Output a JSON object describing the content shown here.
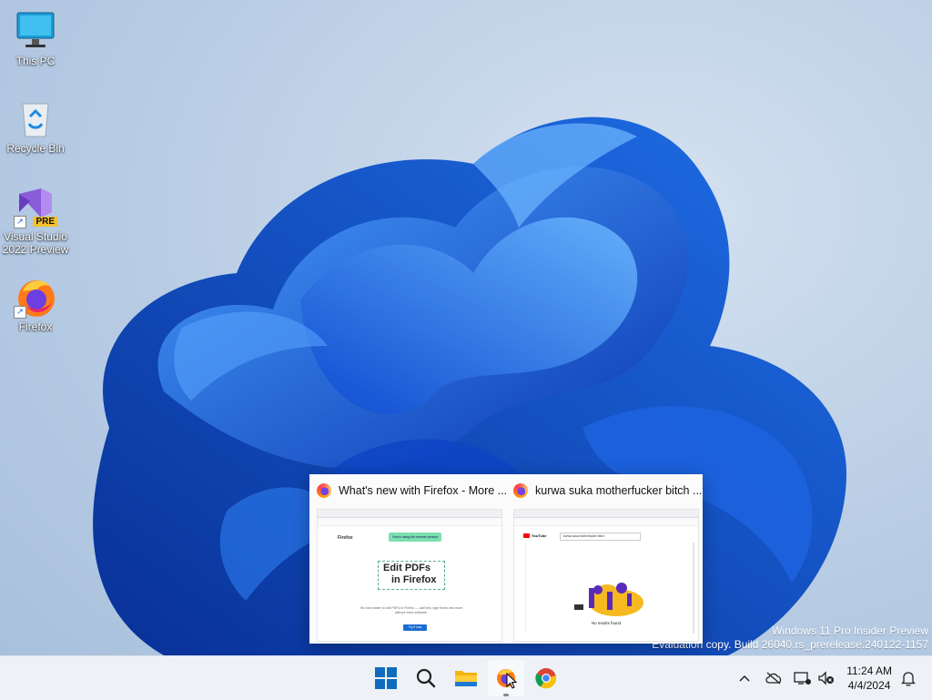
{
  "desktop": {
    "icons": [
      {
        "label_line1": "This PC",
        "label_line2": "",
        "icon": "computer-icon"
      },
      {
        "label_line1": "Recycle Bin",
        "label_line2": "",
        "icon": "recycle-bin-icon"
      },
      {
        "label_line1": "Visual Studio",
        "label_line2": "2022 Preview",
        "icon": "visual-studio-icon",
        "badge": "PRE"
      },
      {
        "label_line1": "Firefox",
        "label_line2": "",
        "icon": "firefox-icon"
      }
    ]
  },
  "watermark": {
    "line1": "Windows 11 Pro Insider Preview",
    "line2": "Evaluation copy. Build 26040.rs_prerelease.240122-1157"
  },
  "preview": {
    "windows": [
      {
        "title": "What's new with Firefox - More ...",
        "page": {
          "brand": "Firefox",
          "banner": "You're using the newest version",
          "headline1": "Edit PDFs",
          "headline2": "in Firefox",
          "body": "It's now easier to edit PDFs in Firefox — add text, sign forms and more without extra software.",
          "button": "Try it now"
        }
      },
      {
        "title": "kurwa suka motherfucker bitch ...",
        "page": {
          "brand": "YouTube",
          "search_value": "kurwa suka motherfucker bitch",
          "empty_text": "No results found"
        }
      }
    ]
  },
  "taskbar": {
    "apps": [
      "start-icon",
      "search-icon",
      "file-explorer-icon",
      "firefox-icon",
      "chrome-icon"
    ],
    "tray": [
      "chevron-up-icon",
      "onedrive-icon",
      "network-icon",
      "volume-icon"
    ],
    "time": "11:24 AM",
    "date": "4/4/2024",
    "notification_icon": "bell-icon"
  },
  "colors": {
    "accent": "#0067c0",
    "bloom_dark": "#0a3bb8",
    "bloom_light": "#3c8df2",
    "taskbar": "#eef1f6"
  }
}
